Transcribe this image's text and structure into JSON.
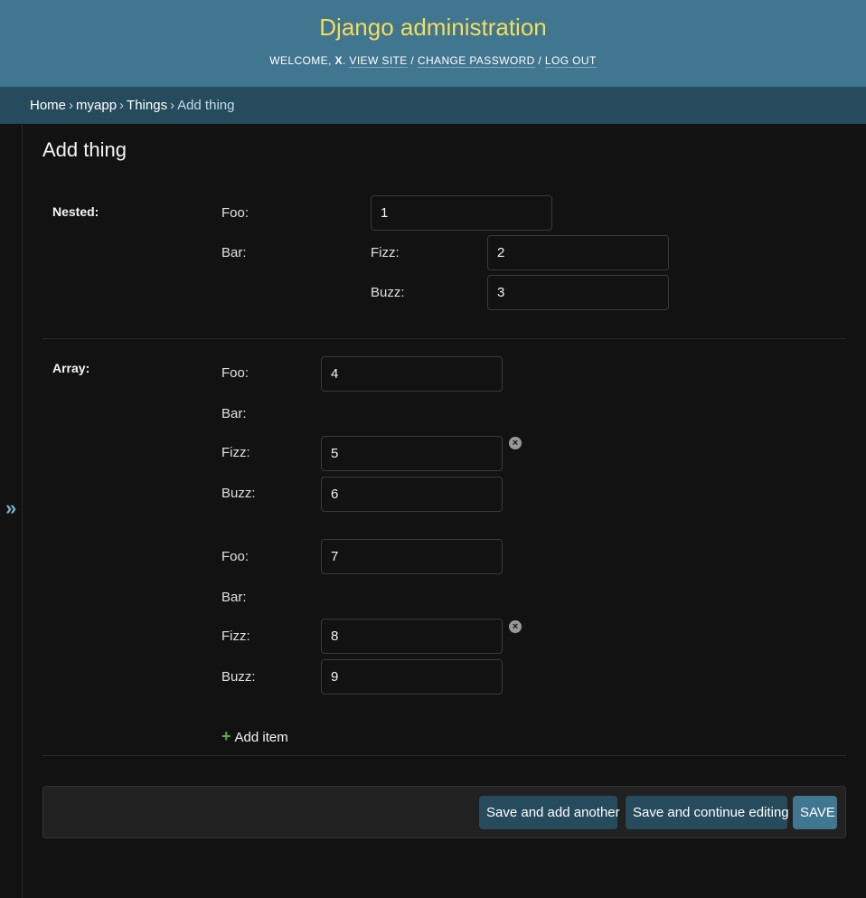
{
  "header": {
    "site_name": "Django administration",
    "welcome": "WELCOME, ",
    "username": "X",
    "view_site": "VIEW SITE",
    "change_password": "CHANGE PASSWORD",
    "log_out": "LOG OUT",
    "separator": " / "
  },
  "breadcrumbs": [
    "Home",
    "myapp",
    "Things",
    "Add thing"
  ],
  "sidebar": {
    "toggle_glyph": "»"
  },
  "page": {
    "title": "Add thing"
  },
  "nested": {
    "label": "Nested:",
    "foo_label": "Foo:",
    "foo_value": "1",
    "bar_label": "Bar:",
    "fizz_label": "Fizz:",
    "fizz_value": "2",
    "buzz_label": "Buzz:",
    "buzz_value": "3"
  },
  "array": {
    "label": "Array:",
    "items": [
      {
        "foo_label": "Foo:",
        "foo_value": "4",
        "bar_label": "Bar:",
        "fizz_label": "Fizz:",
        "fizz_value": "5",
        "buzz_label": "Buzz:",
        "buzz_value": "6"
      },
      {
        "foo_label": "Foo:",
        "foo_value": "7",
        "bar_label": "Bar:",
        "fizz_label": "Fizz:",
        "fizz_value": "8",
        "buzz_label": "Buzz:",
        "buzz_value": "9"
      }
    ],
    "add_item_label": "Add item",
    "remove_icon_glyph": "×"
  },
  "submit_row": {
    "save_add_another": "Save and add another",
    "save_continue": "Save and continue editing",
    "save": "SAVE"
  },
  "colors": {
    "header_bg": "#417690",
    "breadcrumbs_bg": "#264b5d",
    "site_name": "#f5dd5d",
    "add_icon": "#5fad3b"
  }
}
